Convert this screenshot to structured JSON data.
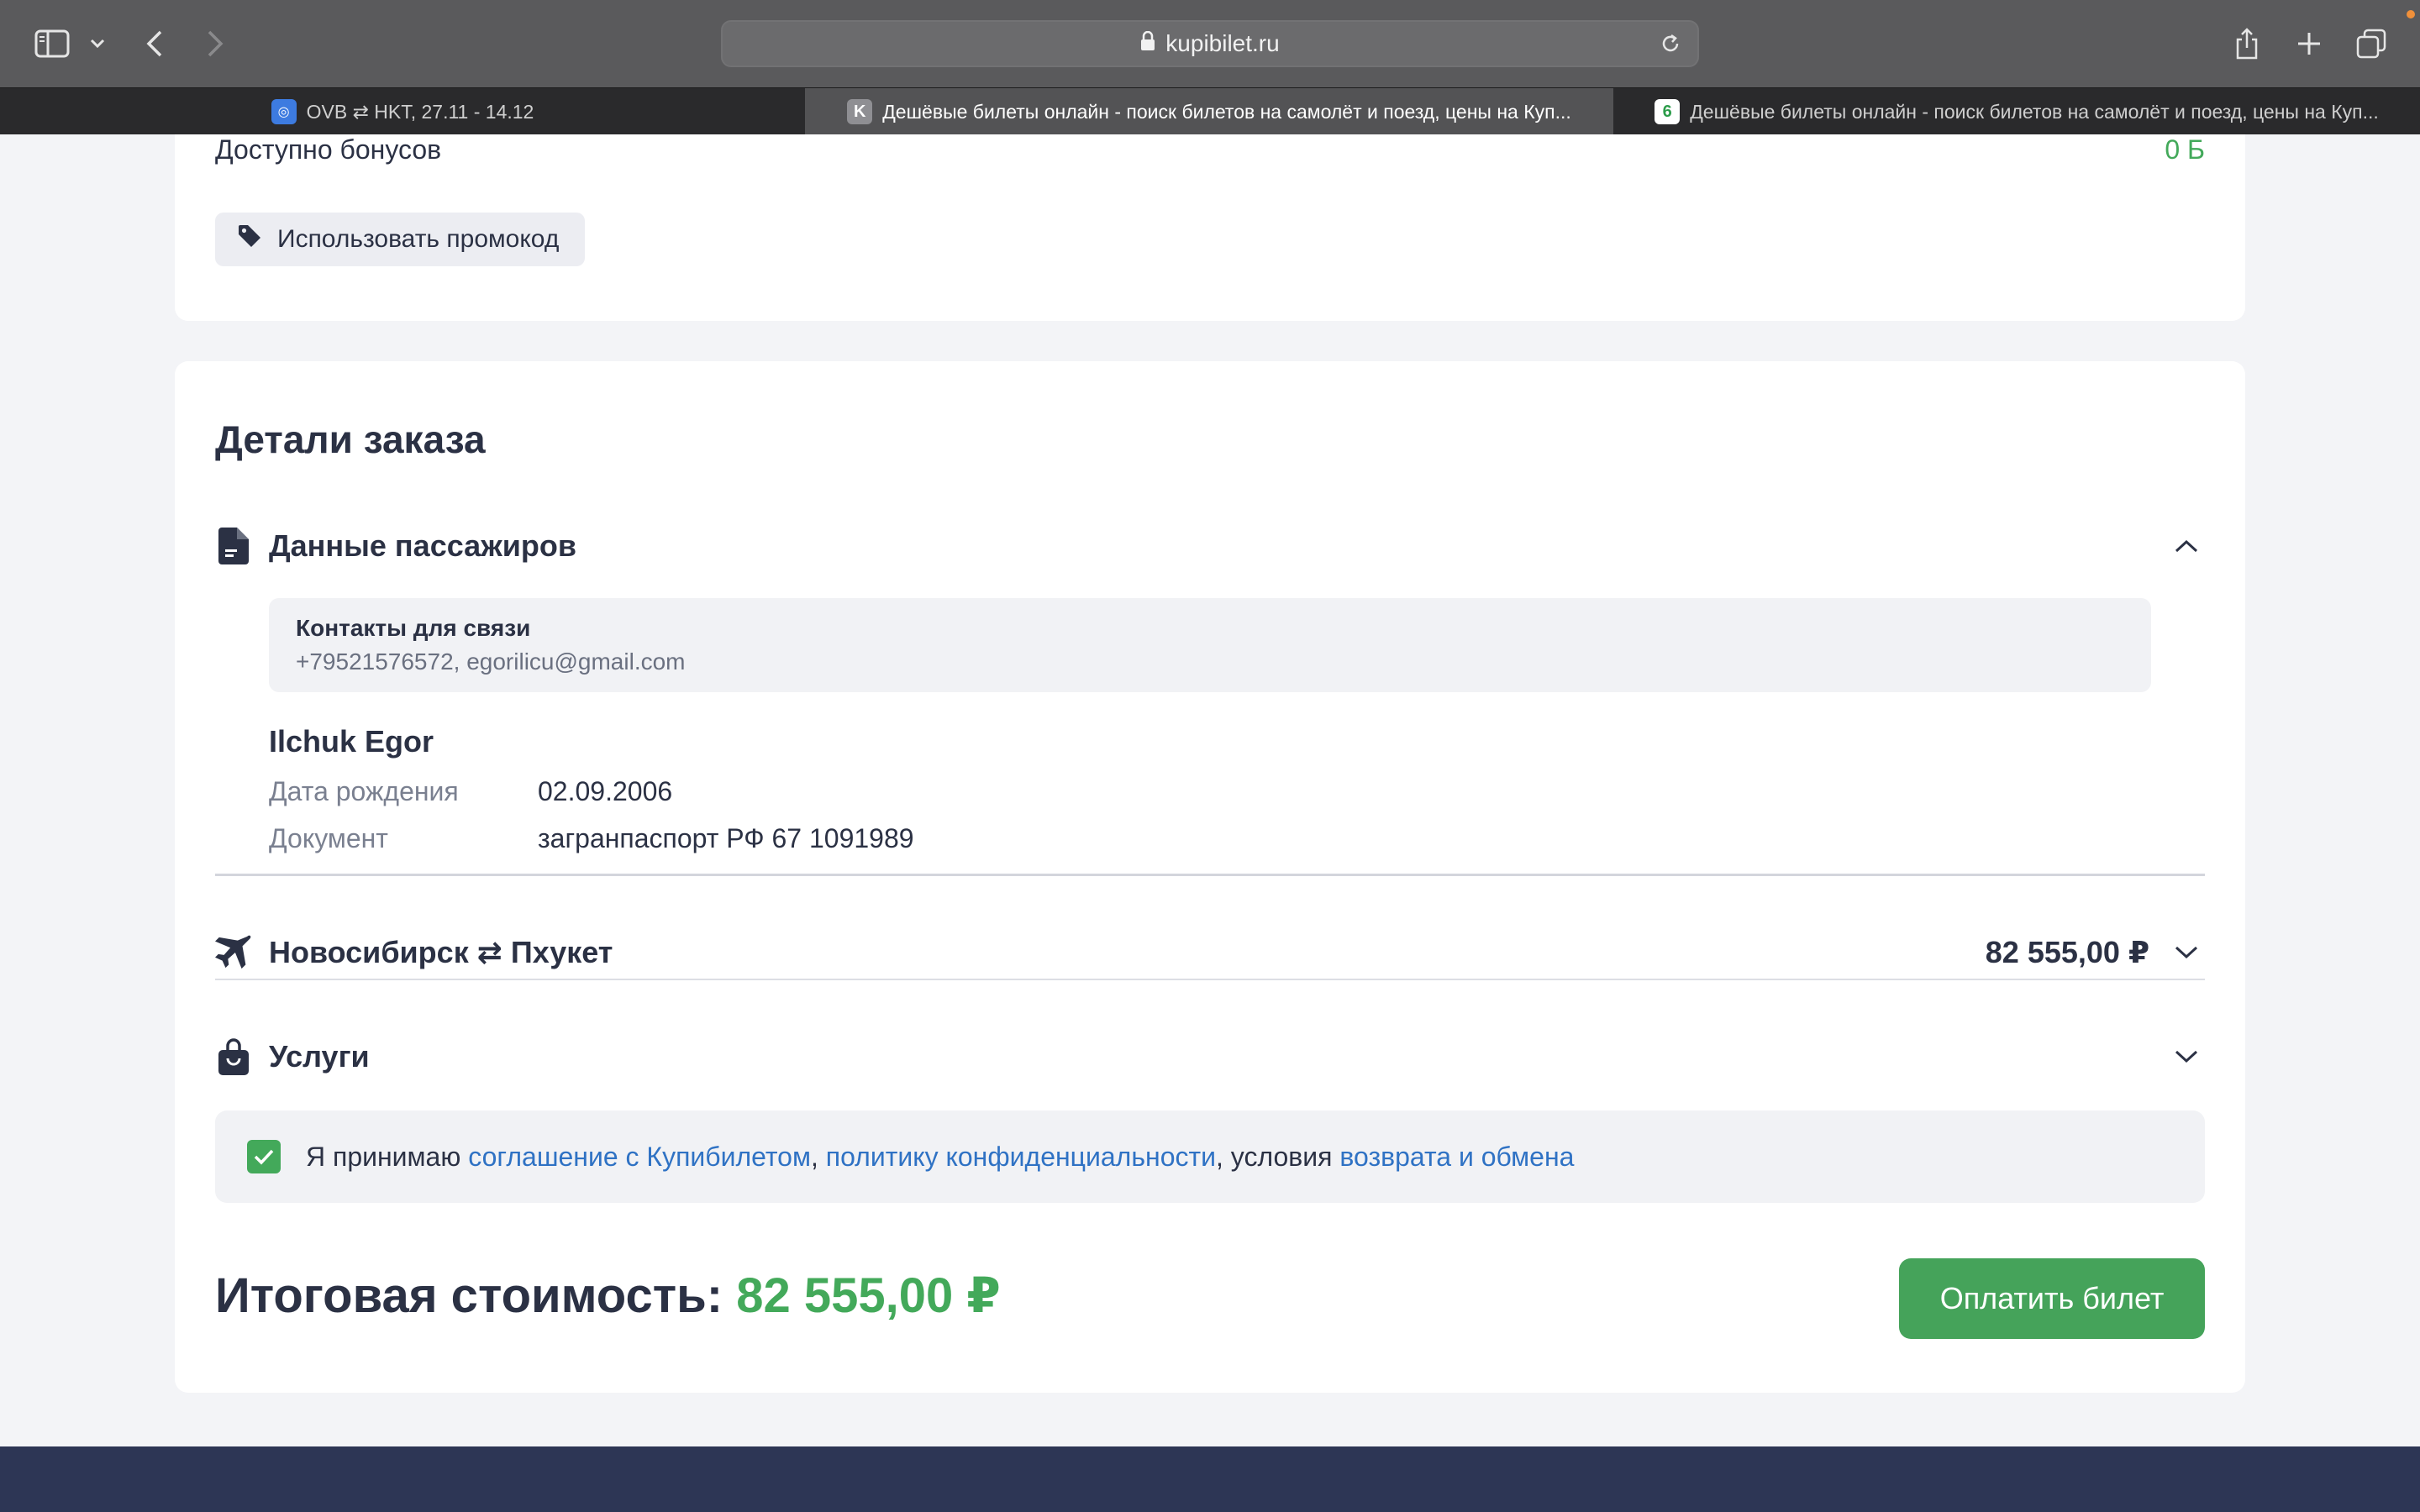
{
  "browser": {
    "url": "kupibilet.ru",
    "tabs": [
      {
        "title": "OVB ⇄ HKT, 27.11 - 14.12",
        "favicon": "K",
        "active": false
      },
      {
        "title": "Дешёвые билеты онлайн - поиск билетов на самолёт и поезд, цены на Куп...",
        "favicon": "K",
        "active": true
      },
      {
        "title": "Дешёвые билеты онлайн - поиск билетов на самолёт и поезд, цены на Куп...",
        "favicon": "6",
        "active": false
      }
    ]
  },
  "bonus": {
    "label": "Доступно бонусов",
    "value": "0 Б",
    "promo_label": "Использовать промокод"
  },
  "order": {
    "title": "Детали заказа",
    "passengers": {
      "label": "Данные пассажиров",
      "contacts_title": "Контакты для связи",
      "contacts_value": "+79521576572, egorilicu@gmail.com",
      "name": "Ilchuk Egor",
      "dob_label": "Дата рождения",
      "dob_value": "02.09.2006",
      "doc_label": "Документ",
      "doc_value": "загранпаспорт РФ 67 1091989"
    },
    "flight": {
      "label": "Новосибирск ⇄ Пхукет",
      "price": "82 555,00 ₽"
    },
    "services": {
      "label": "Услуги"
    },
    "agreement": {
      "prefix": "Я принимаю ",
      "link1": "соглашение с Купибилетом",
      "sep1": ", ",
      "link2": "политику конфиденциальности",
      "sep2": ", условия ",
      "link3": "возврата и обмена",
      "checked": true
    },
    "total_label": "Итоговая стоимость: ",
    "total_value": "82 555,00 ₽",
    "pay_label": "Оплатить билет"
  },
  "colors": {
    "accent_green": "#43a95a",
    "link_blue": "#2f72c4",
    "text_dark": "#2b3144",
    "footer": "#2d3655"
  }
}
